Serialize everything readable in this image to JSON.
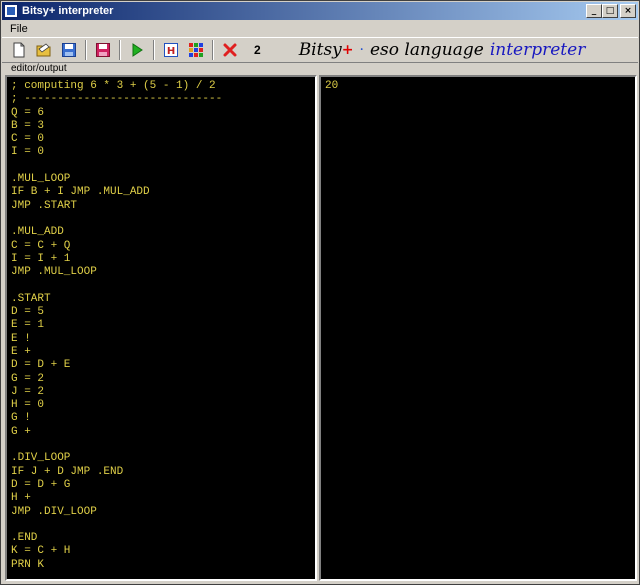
{
  "window": {
    "title": "Bitsy+ interpreter"
  },
  "menu": {
    "file": "File"
  },
  "toolbar": {
    "counter": "2",
    "brand": {
      "name": "Bitsy",
      "plus": "+",
      "sep": "·",
      "middle": "eso language",
      "tail": "interpreter"
    }
  },
  "group": {
    "label": "editor/output"
  },
  "editor": {
    "code": "; computing 6 * 3 + (5 - 1) / 2\n; ------------------------------\nQ = 6\nB = 3\nC = 0\nI = 0\n\n.MUL_LOOP\nIF B + I JMP .MUL_ADD\nJMP .START\n\n.MUL_ADD\nC = C + Q\nI = I + 1\nJMP .MUL_LOOP\n\n.START\nD = 5\nE = 1\nE !\nE +\nD = D + E\nG = 2\nJ = 2\nH = 0\nG !\nG +\n\n.DIV_LOOP\nIF J + D JMP .END\nD = D + G\nH +\nJMP .DIV_LOOP\n\n.END\nK = C + H\nPRN K"
  },
  "output": {
    "text": "20"
  },
  "colors": {
    "code_text": "#e0d048",
    "panel_bg": "#000000",
    "title_bar": "#0a246a"
  }
}
